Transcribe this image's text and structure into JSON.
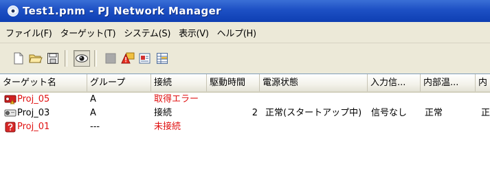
{
  "window": {
    "title": "Test1.pnm - PJ Network Manager"
  },
  "menu": [
    {
      "label": "ファイル(F)"
    },
    {
      "label": "ターゲット(T)"
    },
    {
      "label": "システム(S)"
    },
    {
      "label": "表示(V)"
    },
    {
      "label": "ヘルプ(H)"
    }
  ],
  "toolbar": {
    "buttons": [
      "new-file-icon",
      "open-folder-icon",
      "save-icon",
      "eye-icon",
      "gray-square-icon",
      "warning-icon",
      "properties-icon",
      "grid-icon"
    ]
  },
  "columns": [
    "ターゲット名",
    "グループ",
    "接続",
    "駆動時間",
    "電源状態",
    "入力信...",
    "内部温...",
    "内"
  ],
  "rows": [
    {
      "name": "Proj_05",
      "group": "A",
      "connection": "取得エラー",
      "runtime": "",
      "power": "",
      "input": "",
      "temp": "",
      "extra": "",
      "status": "error"
    },
    {
      "name": "Proj_03",
      "group": "A",
      "connection": "接続",
      "runtime": "2",
      "power": "正常(スタートアップ中)",
      "input": "信号なし",
      "temp": "正常",
      "extra": "正",
      "status": "ok"
    },
    {
      "name": "Proj_01",
      "group": "---",
      "connection": "未接続",
      "runtime": "",
      "power": "",
      "input": "",
      "temp": "",
      "extra": "",
      "status": "disconnected"
    }
  ],
  "colors": {
    "error_text": "#e01010",
    "title_bar": "#1d50c4"
  }
}
